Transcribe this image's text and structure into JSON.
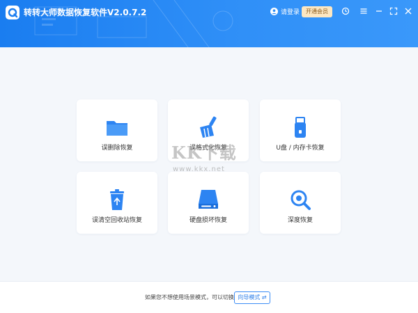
{
  "header": {
    "title": "转转大师数据恢复软件V2.0.7.2",
    "login_label": "请登录",
    "vip_label": "开通会员",
    "accent_color": "#1a7df0",
    "icons": [
      "user-icon",
      "history-icon",
      "menu-icon",
      "minimize-icon",
      "maximize-icon",
      "close-icon"
    ]
  },
  "cards": [
    {
      "label": "误删除恢复",
      "icon": "folder-icon"
    },
    {
      "label": "误格式化恢复",
      "icon": "broom-icon"
    },
    {
      "label": "U盘 / 内存卡恢复",
      "icon": "usb-drive-icon"
    },
    {
      "label": "误清空回收站恢复",
      "icon": "recycle-bin-icon"
    },
    {
      "label": "硬盘损坏恢复",
      "icon": "hard-disk-icon"
    },
    {
      "label": "深度恢复",
      "icon": "deep-scan-icon"
    }
  ],
  "watermark": {
    "brand": "KK下载",
    "url": "www.kkx.net"
  },
  "footer": {
    "hint": "如果您不想使用场景模式，可以切换至",
    "guide_button": "向导模式"
  }
}
